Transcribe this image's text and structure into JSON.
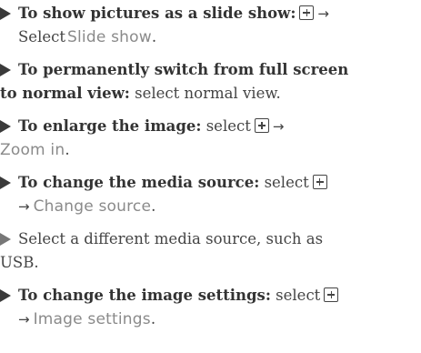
{
  "items": [
    {
      "lead": "To show pictures as a slide show:",
      "arrow": "→",
      "select": "Select",
      "menu": "Slide show",
      "end": "."
    },
    {
      "lead_line1": "To permanently switch from full screen",
      "lead_line2": "to normal view:",
      "rest": "select normal view."
    },
    {
      "lead": "To enlarge the image:",
      "select": "select",
      "arrow": "→",
      "menu": "Zoom in",
      "end": "."
    },
    {
      "lead": "To change the media source:",
      "select": "select",
      "arrow": "→",
      "menu": "Change source",
      "end": "."
    },
    {
      "line1": "Select a different media source, such as",
      "line2": "USB."
    },
    {
      "lead": "To change the image settings:",
      "select": "select",
      "arrow": "→",
      "menu": "Image settings",
      "end": "."
    }
  ],
  "icons": {
    "bullet": "triangle-bullet-icon",
    "add": "plus-box-icon"
  }
}
